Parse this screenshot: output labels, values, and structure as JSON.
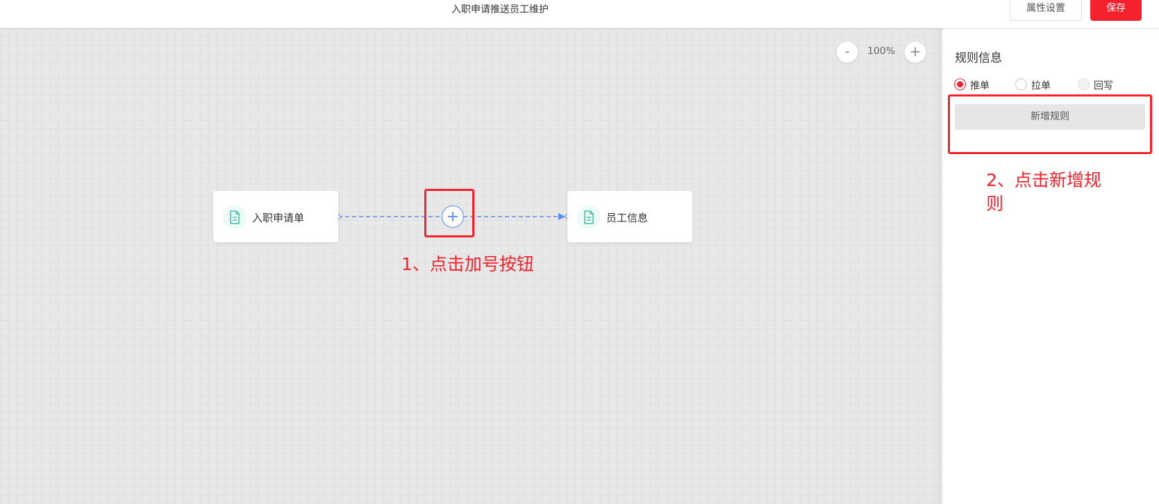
{
  "header": {
    "title": "入职申请推送员工维护",
    "props_button": "属性设置",
    "save_button": "保存"
  },
  "canvas": {
    "zoom_minus": "-",
    "zoom_level": "100%",
    "zoom_plus": "+",
    "nodes": [
      {
        "label": "入职申请单",
        "icon": "document-icon"
      },
      {
        "label": "员工信息",
        "icon": "document-icon"
      }
    ],
    "add_button_icon": "plus-icon"
  },
  "annotations": {
    "step1": "1、点击加号按钮",
    "step2": "2、点击新增规则"
  },
  "panel": {
    "title": "规则信息",
    "radio_options": [
      {
        "label": "推单",
        "state": "checked"
      },
      {
        "label": "拉单",
        "state": "unchecked"
      },
      {
        "label": "回写",
        "state": "disabled"
      }
    ],
    "add_rule_button": "新增规则"
  },
  "colors": {
    "accent_red": "#f5222d",
    "connector_blue": "#5b8def",
    "icon_teal": "#3cbfa0"
  }
}
